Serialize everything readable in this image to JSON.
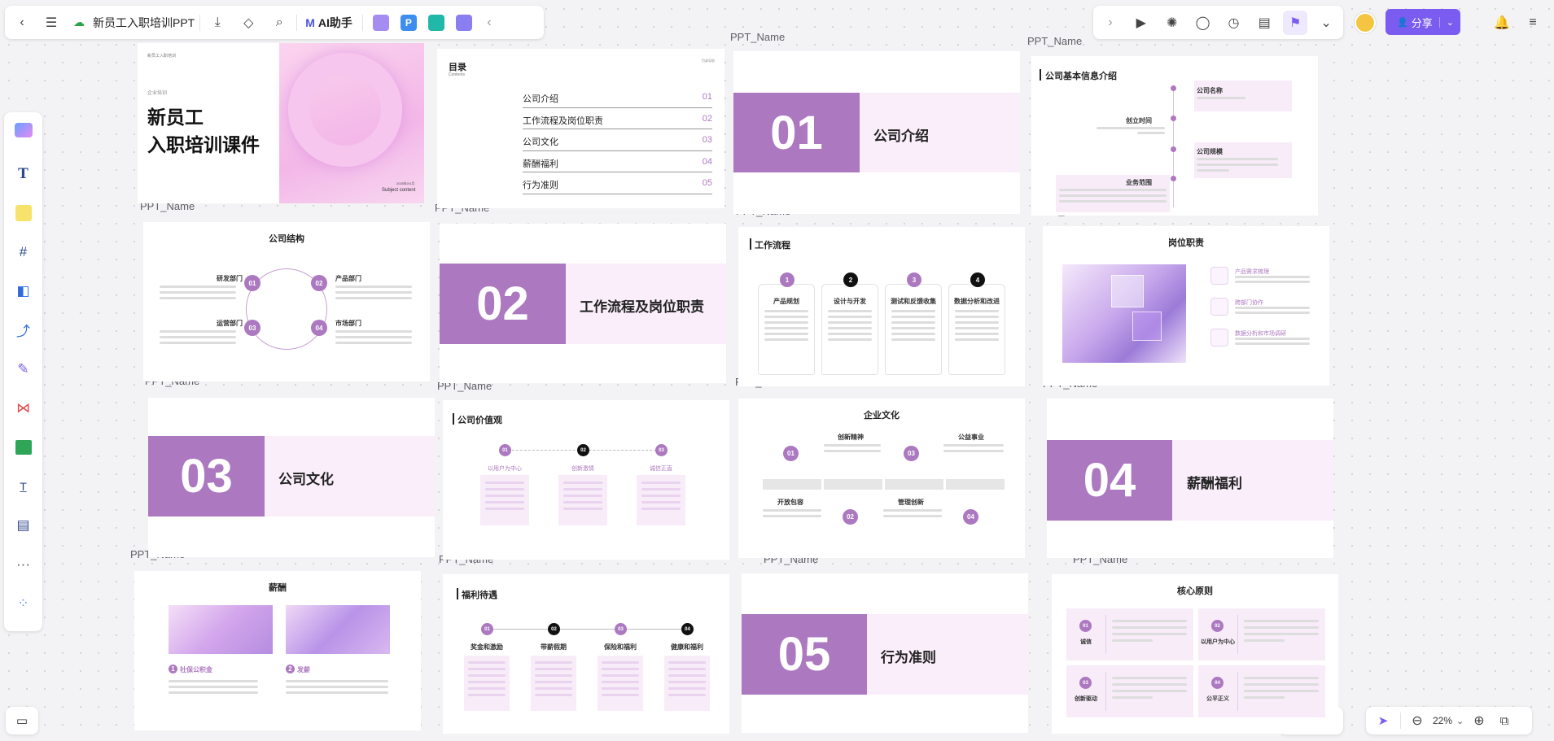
{
  "topbar": {
    "title": "新员工入职培训PPT",
    "ai_label": "AI助手",
    "p_badge": "P"
  },
  "topright": {
    "share_label": "分享"
  },
  "zoom": {
    "value": "22%"
  },
  "frames": {
    "name": "PPT_Name"
  },
  "s1": {
    "title_line1": "新员工",
    "title_line2": "入职培训课件",
    "small_caption": "企业培训",
    "tiny": "新员工入职培训",
    "subject": "Subject content",
    "date": "2025年XX月"
  },
  "s2": {
    "title": "目录",
    "sub": "Contents",
    "corner": "目录导航",
    "items": [
      {
        "label": "公司介绍",
        "num": "01"
      },
      {
        "label": "工作流程及岗位职责",
        "num": "02"
      },
      {
        "label": "公司文化",
        "num": "03"
      },
      {
        "label": "薪酬福利",
        "num": "04"
      },
      {
        "label": "行为准则",
        "num": "05"
      }
    ]
  },
  "s3": {
    "num": "01",
    "title": "公司介绍"
  },
  "s4": {
    "title": "公司基本信息介绍",
    "items": [
      "公司名称",
      "创立时间",
      "公司规模",
      "业务范围"
    ]
  },
  "s5": {
    "title": "公司结构",
    "depts": [
      "研发部门",
      "产品部门",
      "运营部门",
      "市场部门"
    ],
    "nums": [
      "01",
      "02",
      "03",
      "04"
    ]
  },
  "s6": {
    "num": "02",
    "title": "工作流程及岗位职责"
  },
  "s7": {
    "title": "工作流程",
    "nums": [
      "1",
      "2",
      "3",
      "4"
    ],
    "steps": [
      "产品规划",
      "设计与开发",
      "测试和反馈收集",
      "数据分析和改进"
    ]
  },
  "s8": {
    "title": "岗位职责",
    "items": [
      "产品需求梳理",
      "跨部门协作",
      "数据分析和市场调研"
    ]
  },
  "s9": {
    "num": "03",
    "title": "公司文化"
  },
  "s10": {
    "title": "公司价值观",
    "nums": [
      "01",
      "02",
      "03"
    ],
    "items": [
      "以用户为中心",
      "创新激情",
      "诚信正直"
    ]
  },
  "s11": {
    "title": "企业文化",
    "top": [
      "创新精神",
      "公益事业"
    ],
    "bottom": [
      "开放包容",
      "管理创新"
    ],
    "nums": [
      "01",
      "02",
      "03",
      "04"
    ]
  },
  "s12": {
    "num": "04",
    "title": "薪酬福利"
  },
  "s13": {
    "title": "薪酬",
    "items": [
      "社保公积金",
      "发薪"
    ],
    "nums": [
      "1",
      "2"
    ]
  },
  "s14": {
    "title": "福利待遇",
    "nums": [
      "01",
      "02",
      "03",
      "04"
    ],
    "items": [
      "奖金和激励",
      "带薪假期",
      "保险和福利",
      "健康和福利"
    ]
  },
  "s15": {
    "num": "05",
    "title": "行为准则"
  },
  "s16": {
    "title": "核心原则",
    "items": [
      "诚信",
      "以用户为中心",
      "创新驱动",
      "公平正义"
    ],
    "nums": [
      "01",
      "02",
      "03",
      "04"
    ]
  },
  "colors": {
    "accent": "#ac79c0",
    "share": "#7b5cf0",
    "band": "#fbeefb"
  }
}
